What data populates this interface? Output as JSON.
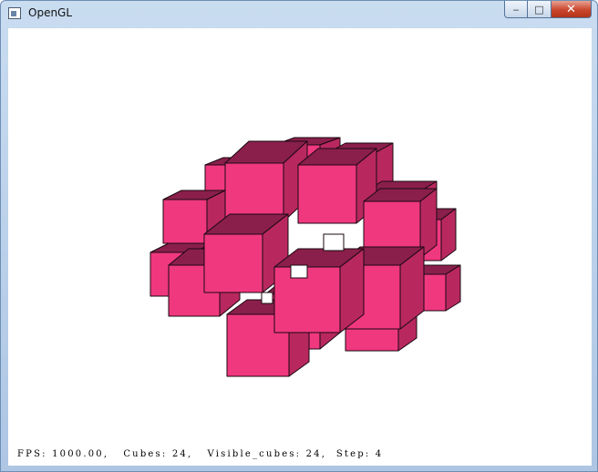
{
  "window": {
    "title": "OpenGL",
    "buttons": {
      "minimize": "‒",
      "maximize": "□",
      "close": "✕"
    }
  },
  "scene": {
    "face_color": "#f0387f",
    "dark_color": "#8a1f4b",
    "mid_color": "#b8285f",
    "edge_color": "#1a0810"
  },
  "status_text": "FPS: 1000.00,   Cubes: 24,   Visible_cubes: 24,  Step: 4"
}
